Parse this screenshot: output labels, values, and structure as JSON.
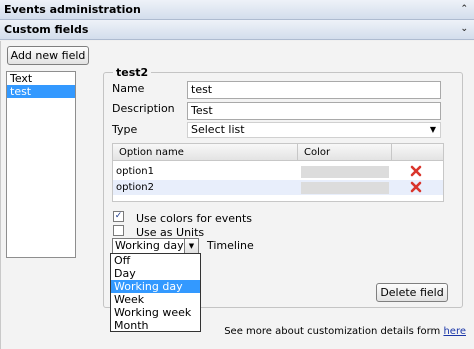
{
  "header": {
    "title": "Events administration",
    "section": "Custom fields"
  },
  "toolbar": {
    "add_label": "Add new field"
  },
  "fields": {
    "items": [
      {
        "label": "Text",
        "selected": false
      },
      {
        "label": "test",
        "selected": true
      }
    ]
  },
  "editor": {
    "legend": "test2",
    "name_label": "Name",
    "name_value": "test",
    "description_label": "Description",
    "description_value": "Test",
    "type_label": "Type",
    "type_value": "Select list",
    "table": {
      "col_option": "Option name",
      "col_color": "Color",
      "rows": [
        {
          "option": "option1"
        },
        {
          "option": "option2"
        }
      ]
    },
    "use_colors_label": "Use colors for events",
    "use_colors_checked": true,
    "use_units_label": "Use as Units",
    "use_units_checked": false,
    "timeline_label": "Timeline",
    "timeline_value": "Working day",
    "timeline_options": [
      "Off",
      "Day",
      "Working day",
      "Week",
      "Working week",
      "Month"
    ],
    "delete_label": "Delete field"
  },
  "footer": {
    "text": "See more about customization details form ",
    "link": "here"
  },
  "icons": {
    "collapse": "chevron-up-icon",
    "expand": "chevron-down-icon",
    "delete": "red-x-icon",
    "check": "checkmark-icon"
  },
  "colors": {
    "selection": "#3399ff",
    "delete": "#d9342b",
    "link": "#1a36a8"
  }
}
